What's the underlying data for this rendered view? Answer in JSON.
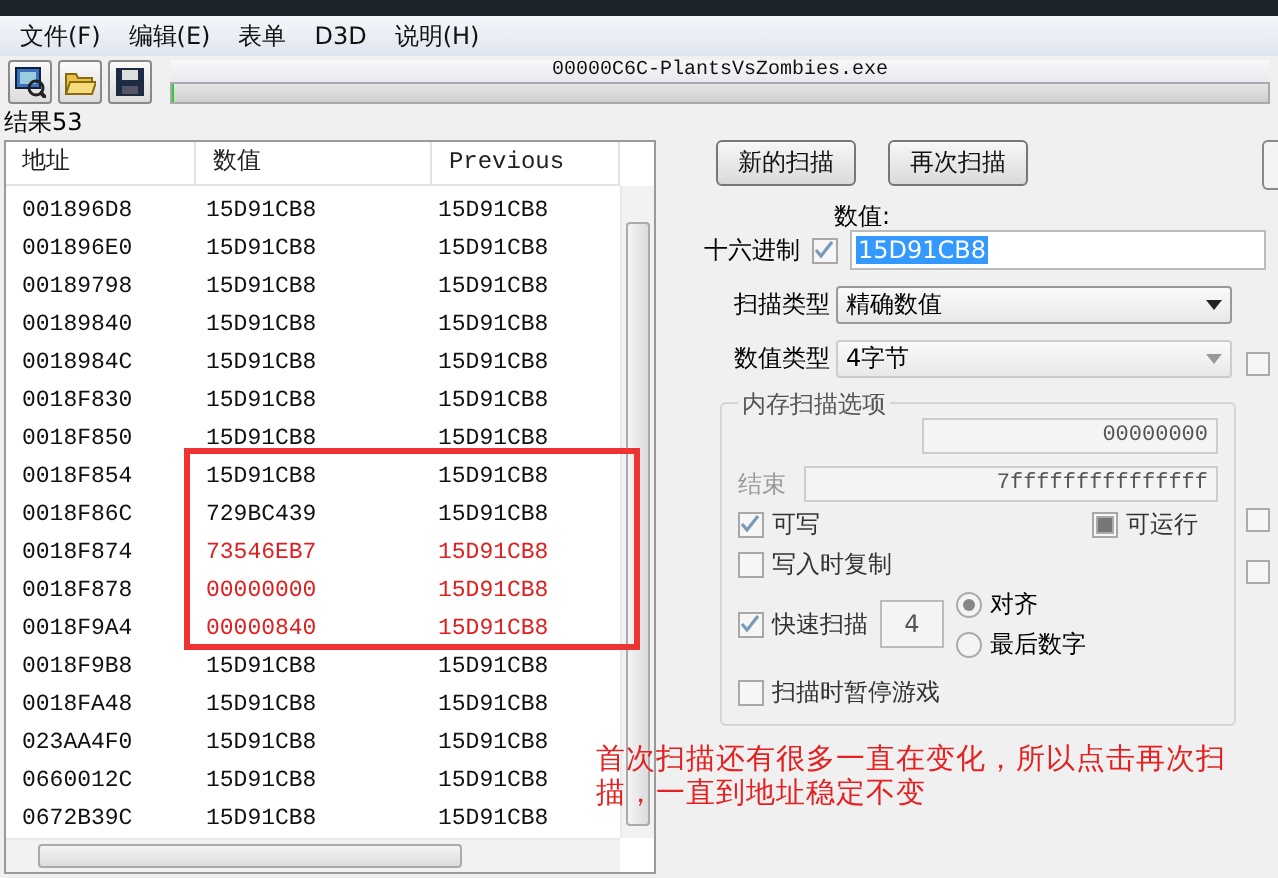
{
  "menu": [
    {
      "label": "文件(F)"
    },
    {
      "label": "编辑(E)"
    },
    {
      "label": "表单"
    },
    {
      "label": "D3D"
    },
    {
      "label": "说明(H)"
    }
  ],
  "toolbar": {
    "process": "00000C6C-PlantsVsZombies.exe",
    "level": 0
  },
  "results": {
    "count_label": "结果53",
    "columns": [
      "地址",
      "数值",
      "Previous"
    ],
    "rows": [
      {
        "address": "001896D8",
        "value": "15D91CB8",
        "previous": "15D91CB8",
        "changed": false
      },
      {
        "address": "001896E0",
        "value": "15D91CB8",
        "previous": "15D91CB8",
        "changed": false
      },
      {
        "address": "00189798",
        "value": "15D91CB8",
        "previous": "15D91CB8",
        "changed": false
      },
      {
        "address": "00189840",
        "value": "15D91CB8",
        "previous": "15D91CB8",
        "changed": false
      },
      {
        "address": "0018984C",
        "value": "15D91CB8",
        "previous": "15D91CB8",
        "changed": false
      },
      {
        "address": "0018F830",
        "value": "15D91CB8",
        "previous": "15D91CB8",
        "changed": false
      },
      {
        "address": "0018F850",
        "value": "15D91CB8",
        "previous": "15D91CB8",
        "changed": false
      },
      {
        "address": "0018F854",
        "value": "15D91CB8",
        "previous": "15D91CB8",
        "changed": false
      },
      {
        "address": "0018F86C",
        "value": "729BC439",
        "previous": "15D91CB8",
        "changed": false
      },
      {
        "address": "0018F874",
        "value": "73546EB7",
        "previous": "15D91CB8",
        "changed": true
      },
      {
        "address": "0018F878",
        "value": "00000000",
        "previous": "15D91CB8",
        "changed": true
      },
      {
        "address": "0018F9A4",
        "value": "00000840",
        "previous": "15D91CB8",
        "changed": true
      },
      {
        "address": "0018F9B8",
        "value": "15D91CB8",
        "previous": "15D91CB8",
        "changed": false
      },
      {
        "address": "0018FA48",
        "value": "15D91CB8",
        "previous": "15D91CB8",
        "changed": false
      },
      {
        "address": "023AA4F0",
        "value": "15D91CB8",
        "previous": "15D91CB8",
        "changed": false
      },
      {
        "address": "0660012C",
        "value": "15D91CB8",
        "previous": "15D91CB8",
        "changed": false
      },
      {
        "address": "0672B39C",
        "value": "15D91CB8",
        "previous": "15D91CB8",
        "changed": false
      }
    ]
  },
  "scan": {
    "buttons": [
      "新的扫描",
      "再次扫描"
    ],
    "value_label": "数值:",
    "hex": {
      "label": "十六进制",
      "checked": true
    },
    "value": "15D91CB8",
    "scan_type": {
      "label": "扫描类型",
      "value": "精确数值"
    },
    "value_type": {
      "label": "数值类型",
      "value": "4字节"
    },
    "side_checks": [
      {
        "checked": false
      },
      {
        "checked": false
      },
      {
        "checked": false
      }
    ],
    "options": {
      "title": "内存扫描选项",
      "start": "00000000",
      "end_label": "结束",
      "end": "7fffffffffffffff",
      "checks": [
        {
          "label": "可写",
          "checked": true,
          "indeterminate": false
        },
        {
          "label": "可运行",
          "indeterminate": true
        },
        {
          "label": "写入时复制",
          "checked": false,
          "indeterminate": false
        }
      ],
      "fast": {
        "label": "快速扫描",
        "checked": true,
        "value": "4"
      },
      "radios": [
        {
          "label": "对齐",
          "selected": true
        },
        {
          "label": "最后数字",
          "selected": false
        }
      ],
      "pause": {
        "label": "扫描时暂停游戏",
        "checked": false
      }
    }
  },
  "note": "首次扫描还有很多一直在变化，所以点击再次扫描，一直到地址稳定不变"
}
